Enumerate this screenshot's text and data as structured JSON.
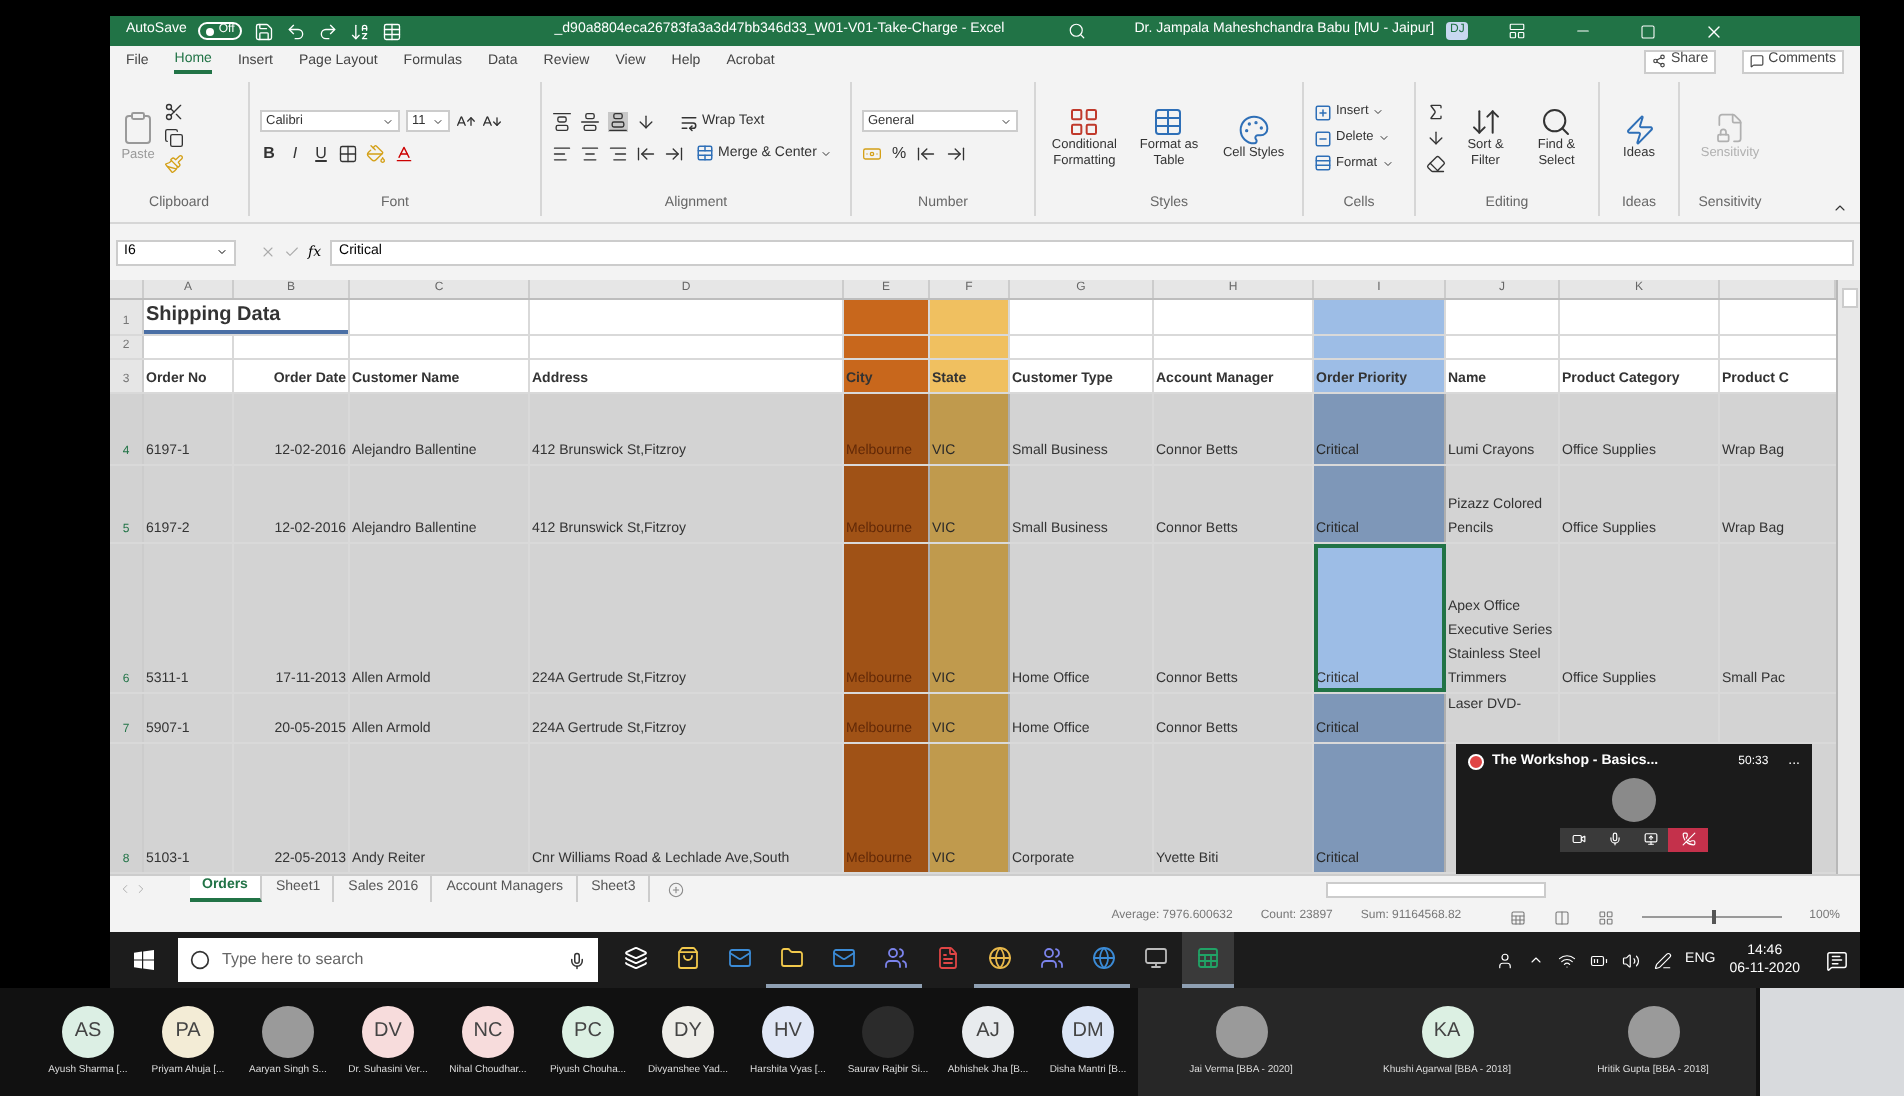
{
  "title_bar": {
    "autosave_label": "AutoSave",
    "autosave_state": "Off",
    "autosave_on": false,
    "title": "_d90a8804eca26783fa3a3d47bb346d33_W01-V01-Take-Charge - Excel",
    "user": "Dr. Jampala Maheshchandra Babu [MU - Jaipur]",
    "user_initials": "DJ"
  },
  "menu_tabs": [
    {
      "label": "File",
      "selected": false
    },
    {
      "label": "Home",
      "selected": true
    },
    {
      "label": "Insert",
      "selected": false
    },
    {
      "label": "Page Layout",
      "selected": false
    },
    {
      "label": "Formulas",
      "selected": false
    },
    {
      "label": "Data",
      "selected": false
    },
    {
      "label": "Review",
      "selected": false
    },
    {
      "label": "View",
      "selected": false
    },
    {
      "label": "Help",
      "selected": false
    },
    {
      "label": "Acrobat",
      "selected": false
    }
  ],
  "share": "Share",
  "comments": "Comments",
  "ribbon": {
    "clipboard": {
      "paste": "Paste",
      "label": "Clipboard"
    },
    "font": {
      "name": "Calibri",
      "size": "11",
      "styles": [
        "B",
        "I",
        "U"
      ],
      "label": "Font"
    },
    "alignment": {
      "wrap": "Wrap Text",
      "merge": "Merge & Center",
      "label": "Alignment"
    },
    "number": {
      "format": "General",
      "symbol": "%",
      "label": "Number"
    },
    "styles": {
      "buttons": [
        "Conditional Formatting",
        "Format as Table",
        "Cell Styles"
      ],
      "label": "Styles"
    },
    "cells": {
      "buttons": [
        "Insert",
        "Delete",
        "Format"
      ],
      "label": "Cells"
    },
    "editing": {
      "buttons": [
        "Sort & Filter",
        "Find & Select"
      ],
      "label": "Editing"
    },
    "ideas": {
      "button": "Ideas",
      "label": "Ideas"
    },
    "sensitivity": {
      "button": "Sensitivity",
      "label": "Sensitivity",
      "disabled": true
    }
  },
  "formula_bar": {
    "name_box": "I6",
    "fx": "fx",
    "value": "Critical"
  },
  "columns": [
    {
      "letter": "A"
    },
    {
      "letter": "B"
    },
    {
      "letter": "C"
    },
    {
      "letter": "D"
    },
    {
      "letter": "E",
      "color": "#c8671c"
    },
    {
      "letter": "F",
      "color": "#f0c060"
    },
    {
      "letter": "G"
    },
    {
      "letter": "H"
    },
    {
      "letter": "I",
      "color": "#9dbde6",
      "active": true
    },
    {
      "letter": "J"
    },
    {
      "letter": "K"
    }
  ],
  "rows": [
    {
      "number": "1",
      "selected": false,
      "title": "Shipping Data",
      "cells": {}
    },
    {
      "number": "2",
      "selected": false,
      "cells": {}
    },
    {
      "number": "3",
      "selected": false,
      "header": true,
      "cells": {
        "A": "Order No",
        "B": "Order Date",
        "C": "Customer Name",
        "D": "Address",
        "E": "City",
        "F": "State",
        "G": "Customer Type",
        "H": "Account Manager",
        "I": "Order Priority",
        "J": "Name",
        "K": "Product Category",
        "column_12": "Product C"
      }
    },
    {
      "number": "4",
      "selected": true,
      "cells": {
        "A": "6197-1",
        "B": "12-02-2016",
        "C": "Alejandro Ballentine",
        "D": "412 Brunswick St,Fitzroy",
        "E": "Melbourne",
        "F": "VIC",
        "G": "Small Business",
        "H": "Connor Betts",
        "I": "Critical",
        "J": "Lumi Crayons",
        "K": "Office Supplies",
        "column_12": "Wrap Bag"
      }
    },
    {
      "number": "5",
      "selected": true,
      "cells": {
        "A": "6197-2",
        "B": "12-02-2016",
        "C": "Alejandro Ballentine",
        "D": "412 Brunswick St,Fitzroy",
        "E": "Melbourne",
        "F": "VIC",
        "G": "Small Business",
        "H": "Connor Betts",
        "I": "Critical",
        "J": "Pizazz Colored Pencils",
        "K": "Office Supplies",
        "column_12": "Wrap Bag"
      }
    },
    {
      "number": "6",
      "selected": true,
      "active": true,
      "cells": {
        "A": "5311-1",
        "B": "17-11-2013",
        "C": "Allen Armold",
        "D": "224A Gertrude St,Fitzroy",
        "E": "Melbourne",
        "F": "VIC",
        "G": "Home Office",
        "H": "Connor Betts",
        "I": "Critical",
        "J": "Apex Office Executive Series Stainless Steel Trimmers",
        "K": "Office Supplies",
        "column_12": "Small Pac"
      }
    },
    {
      "number": "7",
      "selected": true,
      "cells": {
        "A": "5907-1",
        "B": "20-05-2015",
        "C": "Allen Armold",
        "D": "224A Gertrude St,Fitzroy",
        "E": "Melbourne",
        "F": "VIC",
        "G": "Home Office",
        "H": "Connor Betts",
        "I": "Critical",
        "J": "Laser DVD-"
      }
    },
    {
      "number": "8",
      "selected": true,
      "cells": {
        "A": "5103-1",
        "B": "22-05-2013",
        "C": "Andy Reiter",
        "D": "Cnr Williams Road & Lechlade Ave,South",
        "E": "Melbourne",
        "F": "VIC",
        "G": "Corporate",
        "H": "Yvette Biti",
        "I": "Critical"
      }
    }
  ],
  "call_window": {
    "title": "The Workshop - Basics...",
    "time": "50:33",
    "more": "..."
  },
  "sheet_tabs": [
    {
      "label": "Orders",
      "selected": true
    },
    {
      "label": "Sheet1",
      "selected": false
    },
    {
      "label": "Sales 2016",
      "selected": false
    },
    {
      "label": "Account Managers",
      "selected": false
    },
    {
      "label": "Sheet3",
      "selected": false
    }
  ],
  "status_bar": {
    "average": "Average: 7976.600632",
    "count": "Count: 23897",
    "sum": "Sum: 91164568.82",
    "zoom": "100%",
    "zoom_level": {
      "level": 0.5
    }
  },
  "taskbar": {
    "search_placeholder": "Type here to search",
    "apps": [
      {
        "running": false,
        "active": false
      },
      {
        "running": false,
        "active": false
      },
      {
        "running": false,
        "active": false
      },
      {
        "running": true,
        "active": false
      },
      {
        "running": true,
        "active": false
      },
      {
        "running": true,
        "active": false
      },
      {
        "running": false,
        "active": false
      },
      {
        "running": true,
        "active": false
      },
      {
        "running": true,
        "active": false
      },
      {
        "running": true,
        "active": false
      },
      {
        "running": false,
        "active": false
      },
      {
        "running": true,
        "active": true
      }
    ],
    "language": "ENG",
    "time": "14:46",
    "date": "06-11-2020"
  },
  "participants": [
    {
      "kind": "initials",
      "initials": "AS",
      "color": "#dcefe4",
      "name": "Ayush Sharma [..."
    },
    {
      "kind": "initials",
      "initials": "PA",
      "color": "#f3ecd6",
      "name": "Priyam Ahuja [..."
    },
    {
      "kind": "photo",
      "name": "Aaryan Singh S..."
    },
    {
      "kind": "initials",
      "initials": "DV",
      "color": "#f7dcdc",
      "name": "Dr. Suhasini Ver..."
    },
    {
      "kind": "initials",
      "initials": "NC",
      "color": "#f7dcdc",
      "name": "Nihal Choudhar..."
    },
    {
      "kind": "initials",
      "initials": "PC",
      "color": "#dcf0e3",
      "name": "Piyush Chouha..."
    },
    {
      "kind": "initials",
      "initials": "DY",
      "color": "#eeede8",
      "name": "Divyanshee Yad..."
    },
    {
      "kind": "initials",
      "initials": "HV",
      "color": "#e0e7f6",
      "name": "Harshita Vyas [..."
    },
    {
      "kind": "dark",
      "name": "Saurav Rajbir Si..."
    },
    {
      "kind": "initials",
      "initials": "AJ",
      "color": "#e8ebee",
      "name": "Abhishek Jha [B..."
    },
    {
      "kind": "initials",
      "initials": "DM",
      "color": "#dbe5f6",
      "name": "Disha Mantri [B..."
    },
    {
      "kind": "photo",
      "large": true,
      "name": "Jai Verma [BBA - 2020]"
    },
    {
      "kind": "initials",
      "large": true,
      "initials": "KA",
      "color": "#dcf0e3",
      "name": "Khushi Agarwal [BBA - 2018]"
    },
    {
      "kind": "photo",
      "large": true,
      "name": "Hritik Gupta [BBA - 2018]"
    }
  ]
}
